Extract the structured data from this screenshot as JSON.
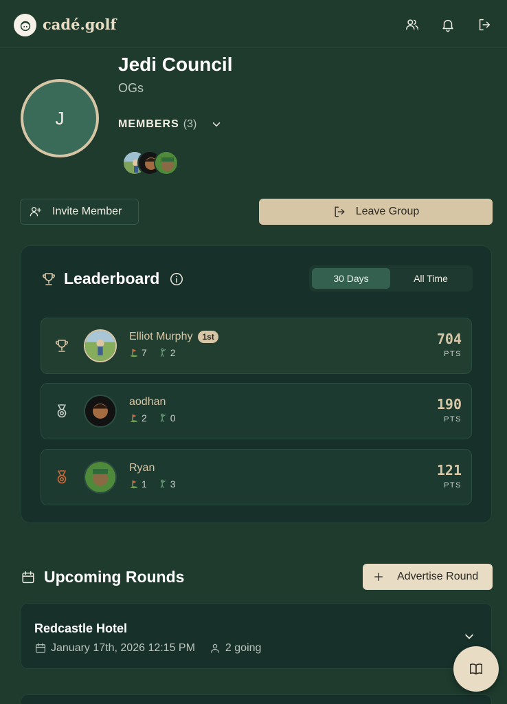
{
  "brand": {
    "name": "cadé.golf"
  },
  "header_icons": [
    "users-icon",
    "bell-icon",
    "logout-icon"
  ],
  "group": {
    "initial": "J",
    "title": "Jedi Council",
    "subtitle": "OGs",
    "members_label": "MEMBERS",
    "members_count": "(3)"
  },
  "actions": {
    "invite_label": "Invite Member",
    "leave_label": "Leave Group"
  },
  "leaderboard": {
    "title": "Leaderboard",
    "toggle": {
      "options": [
        "30 Days",
        "All Time"
      ],
      "selected": "30 Days"
    },
    "rows": [
      {
        "name": "Elliot Murphy",
        "badge": "1st",
        "stat_a": "7",
        "stat_b": "2",
        "points": "704",
        "pts_label": "PTS",
        "rank_icon": "trophy-icon"
      },
      {
        "name": "aodhan",
        "badge": "",
        "stat_a": "2",
        "stat_b": "0",
        "points": "190",
        "pts_label": "PTS",
        "rank_icon": "silver-medal-icon"
      },
      {
        "name": "Ryan",
        "badge": "",
        "stat_a": "1",
        "stat_b": "3",
        "points": "121",
        "pts_label": "PTS",
        "rank_icon": "bronze-medal-icon"
      }
    ]
  },
  "upcoming": {
    "title": "Upcoming Rounds",
    "advertise_label": "Advertise Round",
    "rounds": [
      {
        "name": "Redcastle Hotel",
        "datetime": "January 17th, 2026 12:15 PM",
        "going": "2 going"
      }
    ]
  },
  "colors": {
    "background": "#1e3b2e",
    "accent": "#d7c6a6",
    "card": "#18302a",
    "bronze": "#d2693a"
  }
}
